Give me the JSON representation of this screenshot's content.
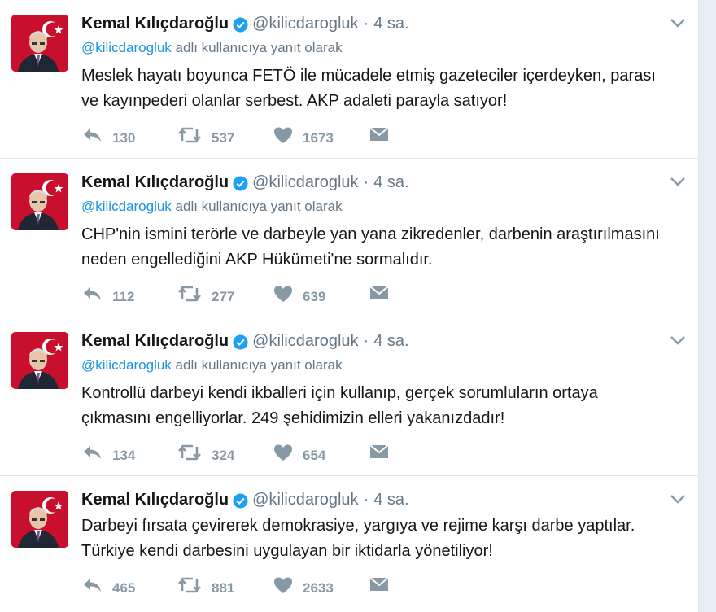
{
  "tweets": [
    {
      "fullname": "Kemal Kılıçdaroğlu",
      "username": "@kilicdarogluk",
      "separator": "·",
      "time": "4 sa.",
      "reply_mention": "@kilicdarogluk",
      "reply_suffix": "adlı kullanıcıya yanıt olarak",
      "text_line1": "Meslek hayatı boyunca FETÖ ile mücadele etmiş gazeteciler içerdeyken, parası",
      "text_line2": "ve kayınpederi olanlar serbest. AKP adaleti parayla satıyor!",
      "replies": "130",
      "retweets": "537",
      "likes": "1673"
    },
    {
      "fullname": "Kemal Kılıçdaroğlu",
      "username": "@kilicdarogluk",
      "separator": "·",
      "time": "4 sa.",
      "reply_mention": "@kilicdarogluk",
      "reply_suffix": "adlı kullanıcıya yanıt olarak",
      "text_line1": "CHP'nin ismini terörle ve darbeyle yan yana zikredenler, darbenin araştırılmasını",
      "text_line2": "neden engellediğini AKP Hükümeti'ne sormalıdır.",
      "replies": "112",
      "retweets": "277",
      "likes": "639"
    },
    {
      "fullname": "Kemal Kılıçdaroğlu",
      "username": "@kilicdarogluk",
      "separator": "·",
      "time": "4 sa.",
      "reply_mention": "@kilicdarogluk",
      "reply_suffix": "adlı kullanıcıya yanıt olarak",
      "text_line1": "Kontrollü darbeyi kendi ikballeri için kullanıp, gerçek sorumluların ortaya",
      "text_line2": "çıkmasını engelliyorlar. 249 şehidimizin elleri yakanızdadır!",
      "replies": "134",
      "retweets": "324",
      "likes": "654"
    },
    {
      "fullname": "Kemal Kılıçdaroğlu",
      "username": "@kilicdarogluk",
      "separator": "·",
      "time": "4 sa.",
      "text_line1": "Darbeyi fırsata çevirerek demokrasiye, yargıya ve rejime karşı darbe yaptılar.",
      "text_line2": "Türkiye kendi darbesini uygulayan bir iktidarla yönetiliyor!",
      "replies": "465",
      "retweets": "881",
      "likes": "2633"
    }
  ],
  "icons": {
    "verified": "verified-badge-icon",
    "caret": "chevron-down-icon",
    "reply": "reply-icon",
    "retweet": "retweet-icon",
    "like": "heart-icon",
    "dm": "envelope-icon"
  },
  "colors": {
    "link": "#1b95e0",
    "muted": "#657786",
    "action": "#8899a6",
    "verified": "#1da1f2",
    "avatar_bg": "#c8102e"
  }
}
